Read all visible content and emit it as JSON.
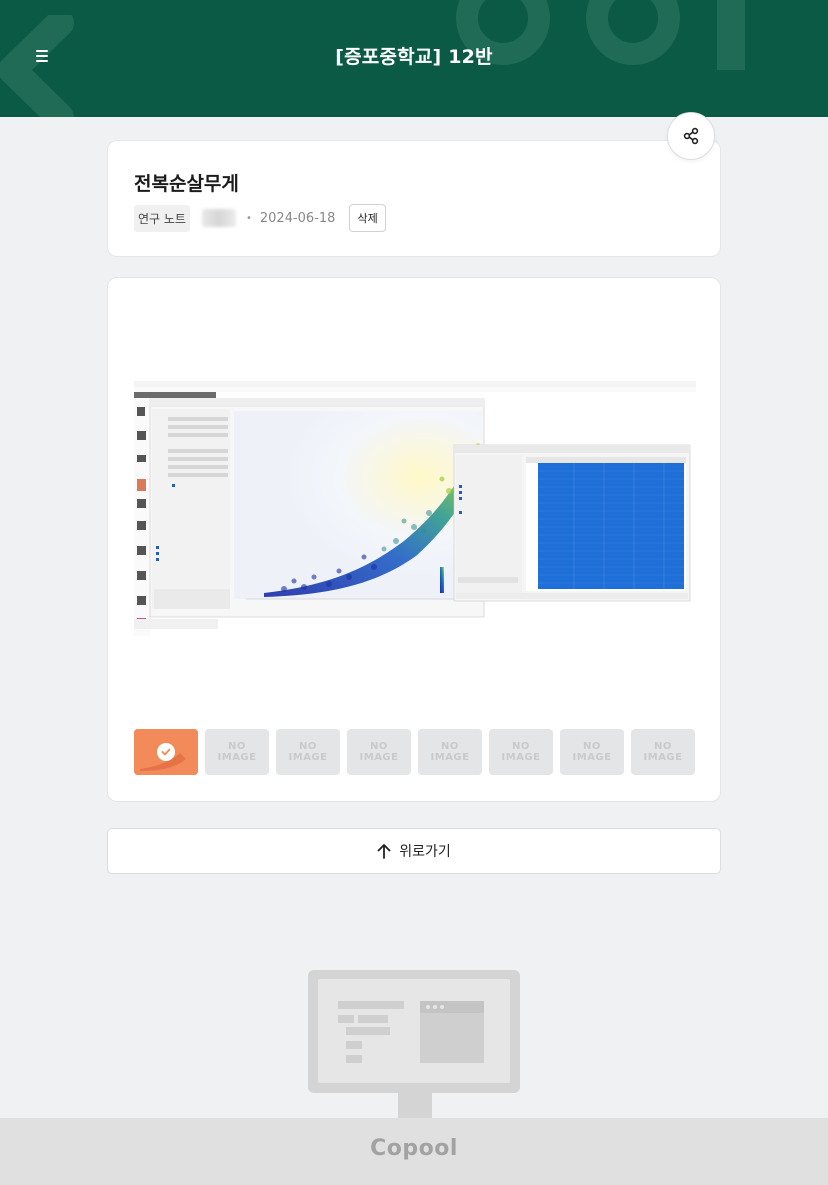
{
  "header": {
    "title": "[증포중학교] 12반"
  },
  "post": {
    "title": "전복순살무게",
    "tag": "연구 노트",
    "date": "2024-06-18",
    "delete_label": "삭제"
  },
  "gallery": {
    "thumbnails": [
      {
        "state": "selected"
      },
      {
        "state": "empty",
        "text_line1": "NO",
        "text_line2": "IMAGE"
      },
      {
        "state": "empty",
        "text_line1": "NO",
        "text_line2": "IMAGE"
      },
      {
        "state": "empty",
        "text_line1": "NO",
        "text_line2": "IMAGE"
      },
      {
        "state": "empty",
        "text_line1": "NO",
        "text_line2": "IMAGE"
      },
      {
        "state": "empty",
        "text_line1": "NO",
        "text_line2": "IMAGE"
      },
      {
        "state": "empty",
        "text_line1": "NO",
        "text_line2": "IMAGE"
      },
      {
        "state": "empty",
        "text_line1": "NO",
        "text_line2": "IMAGE"
      }
    ]
  },
  "scroll_top": {
    "label": "위로가기"
  },
  "footer": {
    "brand": "Copool"
  },
  "colors": {
    "header_bg": "#0b5a45",
    "accent_thumb": "#f28a5a"
  }
}
